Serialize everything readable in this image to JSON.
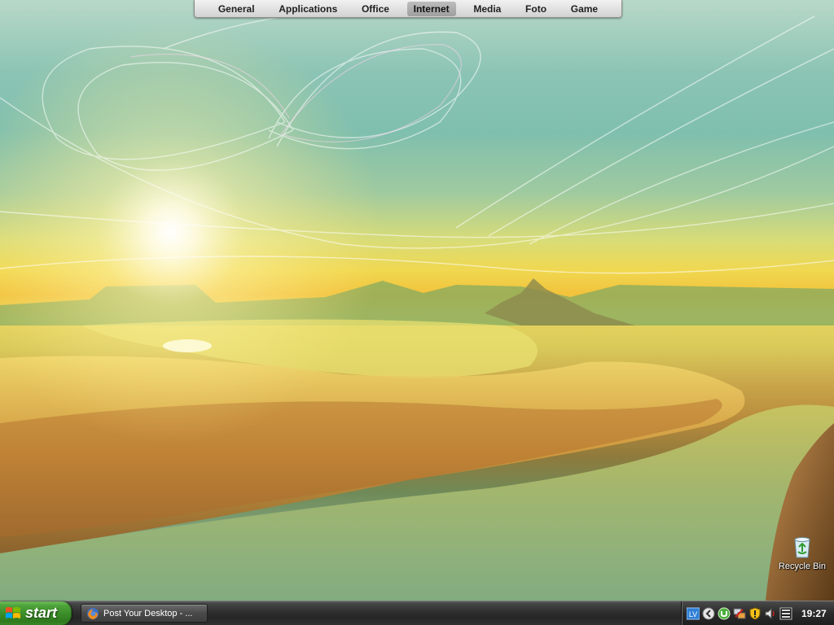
{
  "top_menu": {
    "items": [
      {
        "label": "General"
      },
      {
        "label": "Applications"
      },
      {
        "label": "Office"
      },
      {
        "label": "Internet",
        "active": true
      },
      {
        "label": "Media"
      },
      {
        "label": "Foto"
      },
      {
        "label": "Game"
      }
    ]
  },
  "desktop": {
    "icons": [
      {
        "label": "Recycle Bin",
        "icon": "recycle-bin-icon"
      }
    ]
  },
  "taskbar": {
    "start_label": "start",
    "tasks": [
      {
        "label": "Post Your Desktop - ...",
        "icon": "firefox-icon"
      }
    ],
    "tray": {
      "icons": [
        "lv-icon",
        "back-arrow-icon",
        "utorrent-icon",
        "network-icon",
        "shield-icon",
        "volume-icon",
        "bars-icon"
      ],
      "lv_text": "LV",
      "clock": "19:27"
    }
  },
  "colors": {
    "taskbar": "#2e2e2e",
    "start_button": "#3a8c28",
    "menu_bar": "#e2e2e2",
    "menu_active": "#a8a8a8"
  }
}
